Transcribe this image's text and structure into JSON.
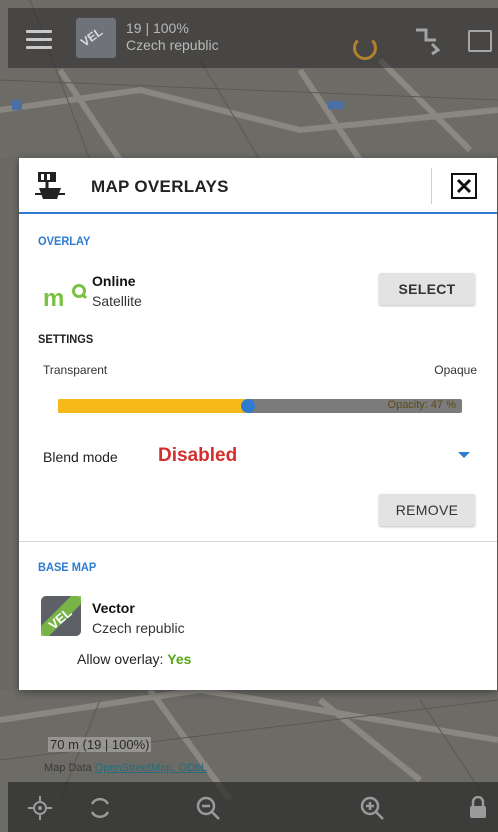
{
  "topbar": {
    "zoom_line": "19 | 100%",
    "map_name": "Czech republic"
  },
  "map": {
    "scale_text": "70 m (19 | 100%)",
    "data_prefix": "Map Data",
    "data_link": "OpenStreetMap, ODbL"
  },
  "dialog": {
    "title": "MAP OVERLAYS",
    "overlay_section": "OVERLAY",
    "overlay_name": "Online",
    "overlay_type": "Satellite",
    "select_label": "SELECT",
    "settings_section": "SETTINGS",
    "slider": {
      "left_label": "Transparent",
      "right_label": "Opaque",
      "opacity_text": "Opacity: 47 %",
      "opacity": 0.47
    },
    "blend": {
      "label": "Blend mode",
      "value": "Disabled"
    },
    "remove_label": "REMOVE",
    "base_section": "BASE MAP",
    "base_name": "Vector",
    "base_region": "Czech republic",
    "allow_label": "Allow overlay:",
    "allow_value": "Yes"
  },
  "colors": {
    "accent": "#2e7bd0",
    "slider_fill": "#f5b91a",
    "disabled_red": "#d32f2f",
    "yes_green": "#58a516",
    "locus_green": "#7cc242"
  },
  "icons": {
    "header": "map-layers-icon",
    "close": "close-icon",
    "overlay": "locus-online-map-icon",
    "base": "vector-map-icon",
    "topbar": [
      "menu-icon",
      "map-thumbnail-icon",
      "gps-icon",
      "route-icon",
      "chart-icon"
    ],
    "bottombar": [
      "gps-target-icon",
      "rotate-icon",
      "zoom-out-icon",
      "zoom-in-icon",
      "lock-icon"
    ]
  }
}
